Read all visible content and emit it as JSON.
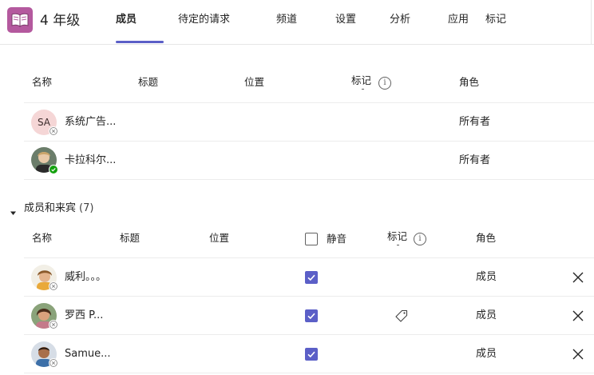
{
  "header": {
    "team_name": "4 年级",
    "tabs": [
      "成员",
      "待定的请求",
      "频道",
      "设置",
      "分析",
      "应用",
      "标记"
    ]
  },
  "owners_table": {
    "columns": [
      "名称",
      "标题",
      "位置",
      "标记",
      "角色"
    ],
    "rows": [
      {
        "initials": "SA",
        "name": "系统广告...",
        "role": "所有者"
      },
      {
        "name": "卡拉科尔...",
        "role": "所有者"
      }
    ]
  },
  "members_section": {
    "title": "成员和来宾",
    "count": "(7)",
    "columns": [
      "名称",
      "标题",
      "位置",
      "静音",
      "标记",
      "角色"
    ],
    "rows": [
      {
        "name": "威利。。。",
        "role": "成员",
        "muted": true
      },
      {
        "name": "罗西 P...",
        "role": "成员",
        "muted": true,
        "has_tag": true
      },
      {
        "name": "Samue...",
        "role": "成员",
        "muted": true
      }
    ]
  },
  "colors": {
    "accent": "#5b5fc7",
    "team_logo": "#b4599e",
    "presence_available": "#13a10e"
  }
}
